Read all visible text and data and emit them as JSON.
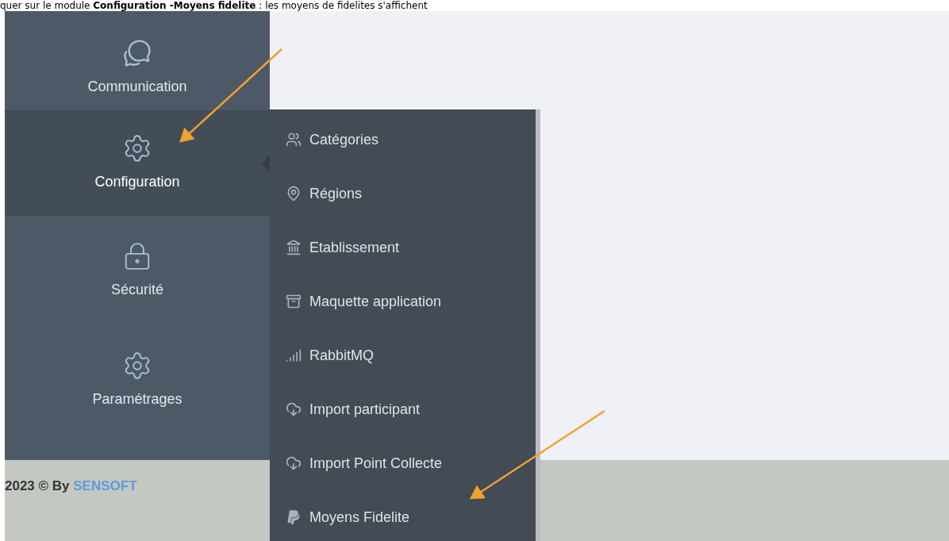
{
  "instruction_text": "quer sur le module **Configuration -Moyens fidelite** : les moyens de fidelites s'affichent",
  "sidebar": {
    "items": [
      {
        "label": "Communication",
        "selected": false
      },
      {
        "label": "Configuration",
        "selected": true
      },
      {
        "label": "Sécurité",
        "selected": false
      },
      {
        "label": "Paramétrages",
        "selected": false
      }
    ]
  },
  "submenu": {
    "items": [
      {
        "label": "Catégories"
      },
      {
        "label": "Régions"
      },
      {
        "label": "Etablissement"
      },
      {
        "label": "Maquette application"
      },
      {
        "label": "RabbitMQ"
      },
      {
        "label": "Import participant"
      },
      {
        "label": "Import Point Collecte"
      },
      {
        "label": "Moyens Fidelite"
      }
    ]
  },
  "footer": {
    "text": "2023 © By",
    "brand": "SENSOFT"
  }
}
